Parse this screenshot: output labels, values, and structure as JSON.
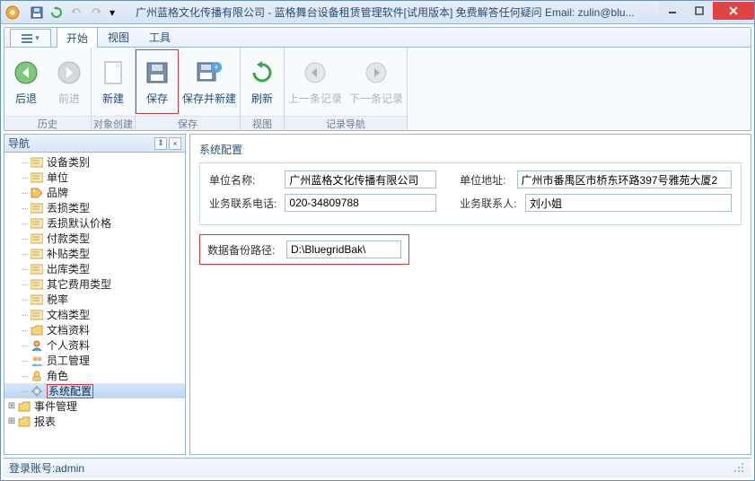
{
  "window": {
    "title": "广州蓝格文化传播有限公司 - 蓝格舞台设备租赁管理软件[试用版本] 免费解答任何疑问 Email: zulin@blu..."
  },
  "qat": {
    "save": "保存",
    "refresh": "刷新",
    "undo": "撤销",
    "redo": "重做"
  },
  "tabs": {
    "start": "开始",
    "view": "视图",
    "tools": "工具"
  },
  "ribbon": {
    "history": {
      "back": "后退",
      "forward": "前进",
      "caption": "历史"
    },
    "create": {
      "new": "新建",
      "caption": "对象创建"
    },
    "save": {
      "save": "保存",
      "saveNew": "保存并新建",
      "caption": "保存"
    },
    "viewg": {
      "refresh": "刷新",
      "caption": "视图"
    },
    "recnav": {
      "prev": "上一条记录",
      "next": "下一条记录",
      "caption": "记录导航"
    }
  },
  "nav": {
    "title": "导航",
    "items": [
      {
        "label": "设备类别",
        "icon": "card-icon"
      },
      {
        "label": "单位",
        "icon": "card-icon"
      },
      {
        "label": "品牌",
        "icon": "tag-icon"
      },
      {
        "label": "丢损类型",
        "icon": "card-icon"
      },
      {
        "label": "丢损默认价格",
        "icon": "card-icon"
      },
      {
        "label": "付款类型",
        "icon": "card-icon"
      },
      {
        "label": "补贴类型",
        "icon": "card-icon"
      },
      {
        "label": "出库类型",
        "icon": "card-icon"
      },
      {
        "label": "其它费用类型",
        "icon": "card-icon"
      },
      {
        "label": "税率",
        "icon": "card-icon"
      },
      {
        "label": "文档类型",
        "icon": "card-icon"
      },
      {
        "label": "文档资料",
        "icon": "folder-icon"
      },
      {
        "label": "个人资料",
        "icon": "person-icon"
      },
      {
        "label": "员工管理",
        "icon": "people-icon"
      },
      {
        "label": "角色",
        "icon": "role-icon"
      },
      {
        "label": "系统配置",
        "icon": "gear-icon",
        "selected": true
      }
    ],
    "footer": [
      {
        "label": "事件管理",
        "icon": "folder-icon",
        "expandable": true
      },
      {
        "label": "报表",
        "icon": "folder-icon",
        "expandable": true
      }
    ]
  },
  "form": {
    "section": "系统配置",
    "company_label": "单位名称:",
    "company_value": "广州蓝格文化传播有限公司",
    "address_label": "单位地址:",
    "address_value": "广州市番禺区市桥东环路397号雅苑大厦2",
    "phone_label": "业务联系电话:",
    "phone_value": "020-34809788",
    "contact_label": "业务联系人:",
    "contact_value": "刘小姐",
    "backup_label": "数据备份路径:",
    "backup_value": "D:\\BluegridBak\\"
  },
  "status": {
    "account_label": "登录账号: ",
    "account": "admin"
  }
}
